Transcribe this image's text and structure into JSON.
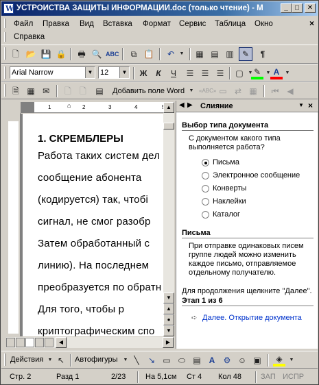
{
  "window": {
    "title": "УСТРОЙСТВА ЗАЩИТЫ ИНФОРМАЦИИ.doc (только чтение) - Micr...",
    "app_icon": "W",
    "minimize": "_",
    "maximize": "□",
    "close": "✕"
  },
  "menu": {
    "items": [
      "Файл",
      "Правка",
      "Вид",
      "Вставка",
      "Формат",
      "Сервис",
      "Таблица",
      "Окно",
      "Справка"
    ],
    "close_doc": "×"
  },
  "format_toolbar": {
    "font": "Arial Narrow",
    "size": "12",
    "bold": "Ж",
    "italic": "К",
    "underline": "Ч"
  },
  "mail_toolbar": {
    "add_field": "Добавить поле Word"
  },
  "ruler": {
    "ticks": [
      "1",
      "2",
      "3",
      "4",
      "5"
    ]
  },
  "document": {
    "heading": "1. СКРЕМБЛЕРЫ",
    "lines": [
      "Работа таких систем дел",
      "сообщение    абонента",
      "(кодируется)  так,  чтобі",
      "сигнал,  не  смог  разобр",
      "Затем   обработанный   с",
      "линию).   На   последнем",
      "преобразуется по обратн",
      "Для    того,    чтобы    р",
      "криптографическим    спо"
    ]
  },
  "taskpane": {
    "title": "Слияние",
    "section1": "Выбор типа документа",
    "question": "С документом какого типа выполняется работа?",
    "options": [
      {
        "label": "Письма",
        "selected": true
      },
      {
        "label": "Электронное сообщение",
        "selected": false
      },
      {
        "label": "Конверты",
        "selected": false
      },
      {
        "label": "Наклейки",
        "selected": false
      },
      {
        "label": "Каталог",
        "selected": false
      }
    ],
    "section2": "Письма",
    "description": "При отправке одинаковых писем группе людей можно изменить каждое письмо, отправляемое отдельному получателю.",
    "continue_hint": "Для продолжения щелкните \"Далее\".",
    "step": "Этап 1 из 6",
    "next_link": "Далее. Открытие документа"
  },
  "draw_toolbar": {
    "actions": "Действия",
    "autoshapes": "Автофигуры"
  },
  "status": {
    "page": "Стр. 2",
    "section": "Разд 1",
    "pages": "2/23",
    "at": "На 5,1см",
    "line": "Ст 4",
    "col": "Кол 48",
    "rec": "ЗАП",
    "ovr": "ИСПР"
  },
  "colors": {
    "title_start": "#0a246a",
    "title_end": "#a6caf0",
    "link": "#0033cc",
    "highlight": "#00ff00",
    "font_color": "#ff0000"
  }
}
